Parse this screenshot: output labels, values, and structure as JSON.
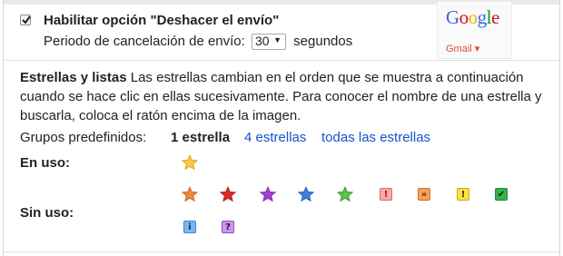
{
  "undo_send": {
    "checked": true,
    "title": "Habilitar opción \"Deshacer el envío\"",
    "period_label": "Periodo de cancelación de envío:",
    "period_value": "30",
    "period_arrow": "▼",
    "period_unit": "segundos"
  },
  "preview": {
    "google_logo": [
      "G",
      "o",
      "o",
      "g",
      "l",
      "e"
    ],
    "google_colors": [
      "#3369e8",
      "#d50f25",
      "#eeb211",
      "#3369e8",
      "#009925",
      "#d50f25"
    ],
    "gmail_menu": "Gmail ▾"
  },
  "stars": {
    "heading": "Estrellas y listas",
    "description": "Las estrellas cambian en el orden que se muestra a continuación cuando se hace clic en ellas sucesivamente. Para conocer el nombre de una estrella y buscarla, coloca el ratón encima de la imagen.",
    "groups_label": "Grupos predefinidos:",
    "group_current": "1 estrella",
    "group_4": "4 estrellas",
    "group_all": "todas las estrellas",
    "in_use_label": "En uso:",
    "not_in_use_label": "Sin uso:",
    "in_use": [
      {
        "kind": "star",
        "name": "yellow-star-icon",
        "fill": "#f7c948",
        "stroke": "#d9a51b"
      }
    ],
    "not_in_use": [
      {
        "kind": "star",
        "name": "orange-star-icon",
        "fill": "#f0883d",
        "stroke": "#c9692a"
      },
      {
        "kind": "star",
        "name": "red-star-icon",
        "fill": "#dd2b2b",
        "stroke": "#b31f1f"
      },
      {
        "kind": "star",
        "name": "purple-star-icon",
        "fill": "#a33fd8",
        "stroke": "#7f2caf"
      },
      {
        "kind": "star",
        "name": "blue-star-icon",
        "fill": "#3f7fe0",
        "stroke": "#2c61b3"
      },
      {
        "kind": "star",
        "name": "green-star-icon",
        "fill": "#5fc24a",
        "stroke": "#43992f"
      },
      {
        "kind": "tag",
        "name": "red-bang-icon",
        "glyph": "!",
        "bg": "#f8a9a9",
        "border": "#d86a6a",
        "color": "#c11010"
      },
      {
        "kind": "tag",
        "name": "orange-guillemet-icon",
        "glyph": "»",
        "bg": "#f6a15a",
        "border": "#c97230",
        "color": "#6a2e00"
      },
      {
        "kind": "tag",
        "name": "yellow-bang-icon",
        "glyph": "!",
        "bg": "#fbe240",
        "border": "#c9ad18",
        "color": "#3b3000"
      },
      {
        "kind": "tag",
        "name": "green-check-icon",
        "glyph": "✔",
        "bg": "#36b24b",
        "border": "#1f8a33",
        "color": "#0c2e10"
      },
      {
        "kind": "tag",
        "name": "blue-info-icon",
        "glyph": "i",
        "bg": "#7cb8f0",
        "border": "#3e84c9",
        "color": "#0a2f66"
      },
      {
        "kind": "tag",
        "name": "purple-question-icon",
        "glyph": "?",
        "bg": "#c896f0",
        "border": "#8f52c2",
        "color": "#2e0b4d"
      }
    ]
  }
}
